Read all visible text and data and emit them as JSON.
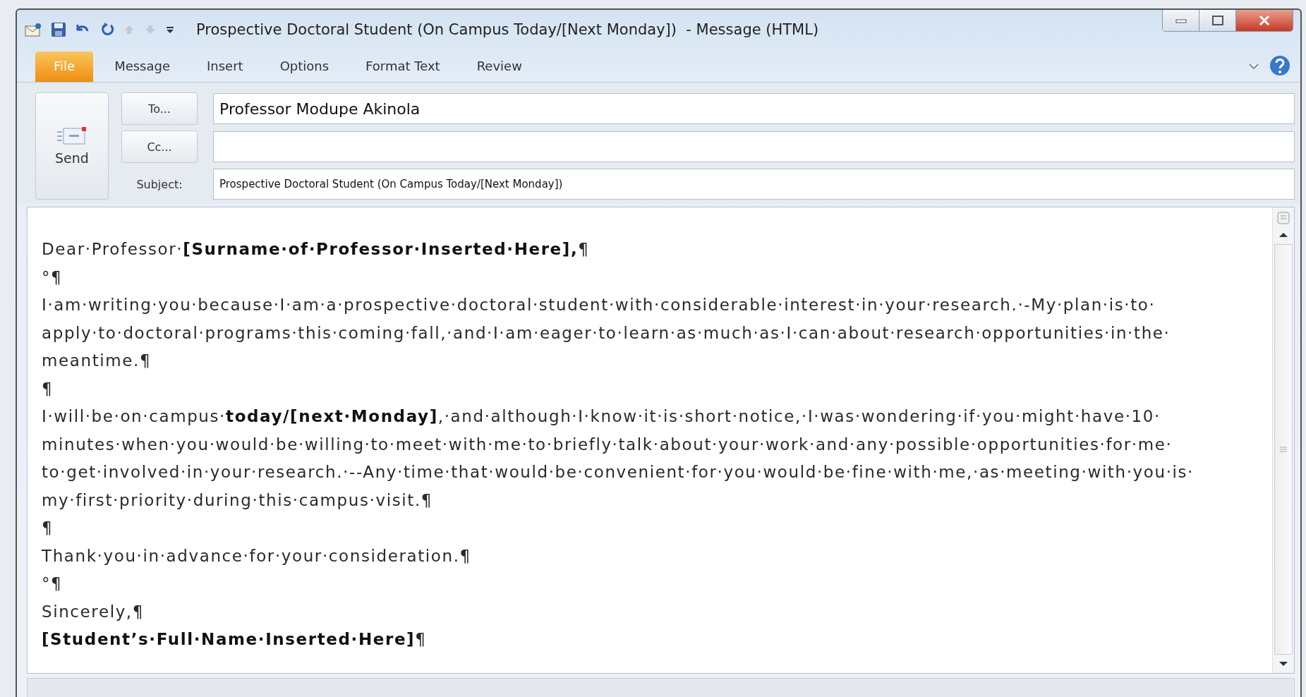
{
  "window": {
    "title": "Prospective Doctoral Student (On Campus Today/[Next Monday])  - Message (HTML)"
  },
  "tabs": [
    {
      "label": "File",
      "kind": "backstage"
    },
    {
      "label": "Message",
      "kind": "tab"
    },
    {
      "label": "Insert",
      "kind": "tab"
    },
    {
      "label": "Options",
      "kind": "tab"
    },
    {
      "label": "Format Text",
      "kind": "tab"
    },
    {
      "label": "Review",
      "kind": "tab"
    }
  ],
  "send_button": {
    "label": "Send"
  },
  "address_fields": [
    {
      "button": "To...",
      "value": "Professor Modupe Akinola"
    },
    {
      "button": "Cc..."
    }
  ],
  "subject": {
    "label": "Subject:",
    "value": "Prospective Doctoral Student (On Campus Today/[Next Monday])"
  },
  "body": {
    "lines": [
      "Dear·Professor·**[Surname·of·Professor·Inserted·Here],**¶",
      "°¶",
      "I·am·writing·you·because·I·am·a·prospective·doctoral·student·with·considerable·interest·in·your·research.·-My·plan·is·to·",
      "apply·to·doctoral·programs·this·coming·fall,·and·I·am·eager·to·learn·as·much·as·I·can·about·research·opportunities·in·the·",
      "meantime.¶",
      "¶",
      "I·will·be·on·campus·**today/[next·Monday]**,·and·although·I·know·it·is·short·notice,·I·was·wondering·if·you·might·have·10·",
      "minutes·when·you·would·be·willing·to·meet·with·me·to·briefly·talk·about·your·work·and·any·possible·opportunities·for·me·",
      "to·get·involved·in·your·research.·--Any·time·that·would·be·convenient·for·you·would·be·fine·with·me,·as·meeting·with·you·is·",
      "my·first·priority·during·this·campus·visit.¶",
      "¶",
      "Thank·you·in·advance·for·your·consideration.¶",
      "°¶",
      "Sincerely,¶",
      "**[Student’s·Full·Name·Inserted·Here]**¶"
    ]
  }
}
